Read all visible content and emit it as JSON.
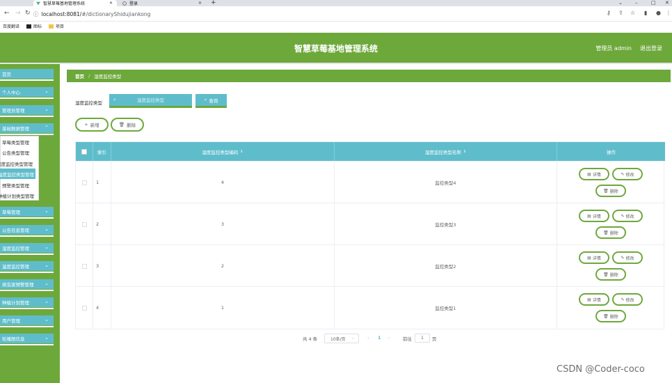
{
  "browser": {
    "tabs": [
      {
        "title": "智慧草莓基地管理系统",
        "active": true
      },
      {
        "title": "登录",
        "active": false
      }
    ],
    "url_host": "localhost:8081/",
    "url_path": "#/dictionaryShidujiankong",
    "bookmarks": [
      "百度翻译",
      "图标",
      "项目"
    ]
  },
  "header": {
    "title": "智慧草莓基地管理系统",
    "user": "管理员 admin",
    "logout": "退出登录"
  },
  "sidebar": {
    "items": [
      {
        "label": "首页",
        "has_chevron": false
      },
      {
        "label": "个人中心",
        "has_chevron": true
      },
      {
        "label": "管理员管理",
        "has_chevron": true
      },
      {
        "label": "基础数据管理",
        "has_chevron": true
      },
      {
        "label": "草莓管理",
        "has_chevron": true
      },
      {
        "label": "公告信息管理",
        "has_chevron": true
      },
      {
        "label": "湿度监控管理",
        "has_chevron": true
      },
      {
        "label": "温度监控管理",
        "has_chevron": true
      },
      {
        "label": "病虫害预警管理",
        "has_chevron": true
      },
      {
        "label": "种植计划管理",
        "has_chevron": true
      },
      {
        "label": "用户管理",
        "has_chevron": true
      },
      {
        "label": "轮播图信息",
        "has_chevron": true
      }
    ],
    "submenu": [
      {
        "label": "草莓类型管理"
      },
      {
        "label": "公告类型管理"
      },
      {
        "label": "湿度监控类型管理"
      },
      {
        "label": "温度监控类型管理"
      },
      {
        "label": "预警类型管理"
      },
      {
        "label": "种植计划类型管理"
      }
    ]
  },
  "breadcrumb": {
    "home": "首页",
    "sep": "/",
    "current": "湿度监控类型"
  },
  "search": {
    "label": "湿度监控类型",
    "placeholder": "湿度监控类型",
    "button": "查询"
  },
  "actions": {
    "add": "新增",
    "delete": "删除"
  },
  "table": {
    "columns": [
      "索引",
      "湿度监控类型编码",
      "湿度监控类型名称",
      "操作"
    ],
    "rows": [
      {
        "index": "1",
        "code": "4",
        "name": "监控类型4"
      },
      {
        "index": "2",
        "code": "3",
        "name": "监控类型3"
      },
      {
        "index": "3",
        "code": "2",
        "name": "监控类型2"
      },
      {
        "index": "4",
        "code": "1",
        "name": "监控类型1"
      }
    ],
    "ops": {
      "detail": "详情",
      "edit": "修改",
      "delete": "删除"
    }
  },
  "pagination": {
    "total": "共 4 条",
    "page_size": "10条/页",
    "prev": "‹",
    "current": "1",
    "next": "›",
    "goto_label": "前往",
    "goto_value": "1",
    "goto_unit": "页"
  },
  "watermark": "CSDN @Coder-coco",
  "colors": {
    "primary_green": "#6da83b",
    "accent_teal": "#5fbdcb"
  }
}
